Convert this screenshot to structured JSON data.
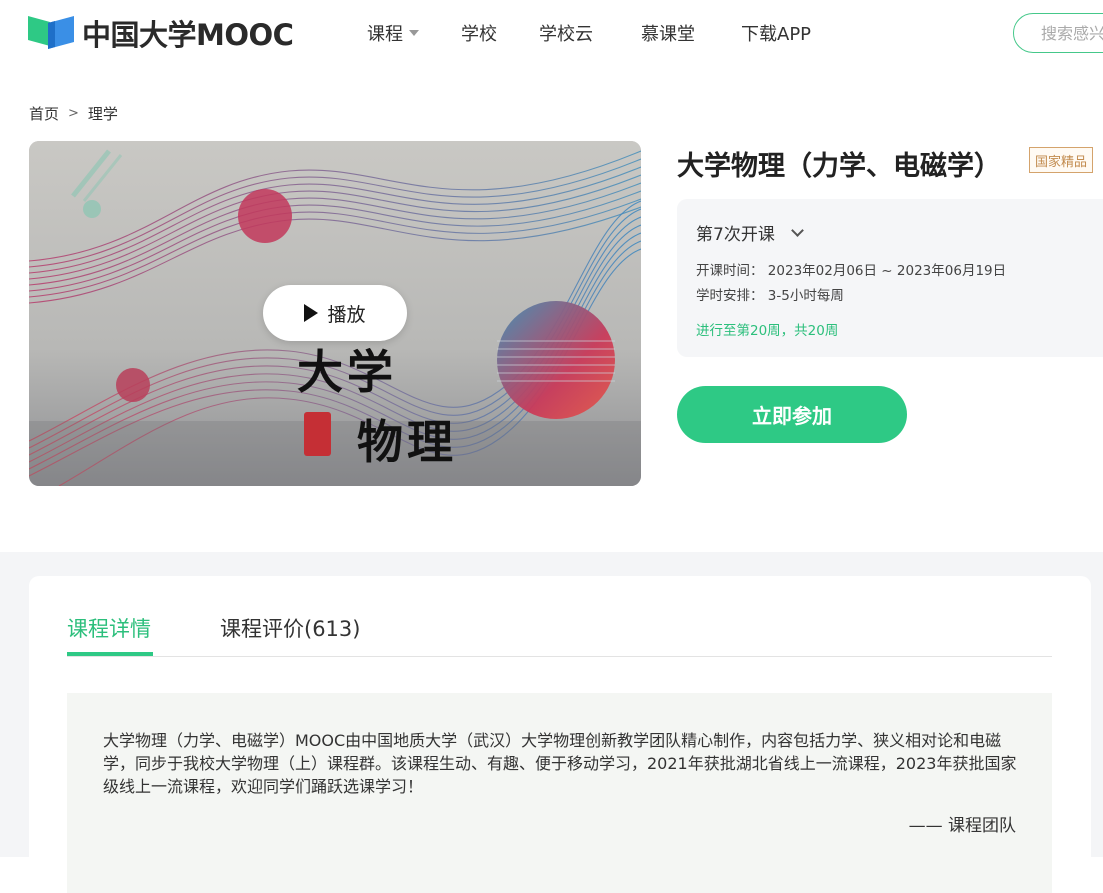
{
  "header": {
    "logo_text": "中国大学MOOC",
    "nav": [
      {
        "label": "课程",
        "has_dropdown": true
      },
      {
        "label": "学校",
        "has_dropdown": false
      },
      {
        "label": "学校云",
        "has_dropdown": false
      },
      {
        "label": "慕课堂",
        "has_dropdown": false
      },
      {
        "label": "下载APP",
        "has_dropdown": false
      }
    ],
    "search_placeholder": "搜索感兴"
  },
  "breadcrumb": {
    "home": "首页",
    "separator": ">",
    "category": "理学"
  },
  "cover": {
    "play_label": "播放",
    "title_line1": "大学",
    "title_line2": "物理"
  },
  "course": {
    "title": "大学物理（力学、电磁学）",
    "badge": "国家精品",
    "term": "第7次开课",
    "schedule_label": "开课时间：",
    "schedule_value": "2023年02月06日 ~ 2023年06月19日",
    "hours_label": "学时安排：",
    "hours_value": "3-5小时每周",
    "progress": "进行至第20周，共20周",
    "join_label": "立即参加"
  },
  "tabs": [
    {
      "label": "课程详情",
      "active": true
    },
    {
      "label": "课程评价(613)",
      "active": false
    }
  ],
  "description": {
    "text": "大学物理（力学、电磁学）MOOC由中国地质大学（武汉）大学物理创新教学团队精心制作，内容包括力学、狭义相对论和电磁学，同步于我校大学物理（上）课程群。该课程生动、有趣、便于移动学习，2021年获批湖北省线上一流课程，2023年获批国家级线上一流课程，欢迎同学们踊跃选课学习！",
    "signature": "—— 课程团队"
  },
  "colors": {
    "accent_green": "#2ec985",
    "badge_gold": "#c28b4e"
  }
}
